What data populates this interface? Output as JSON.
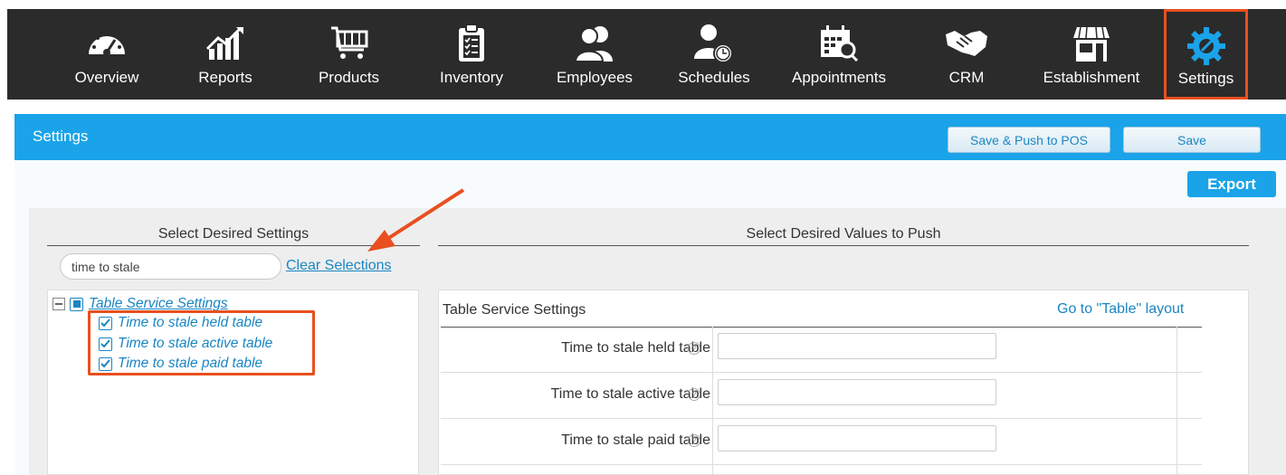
{
  "nav": {
    "items": [
      {
        "label": "Overview",
        "icon": "speedometer-icon"
      },
      {
        "label": "Reports",
        "icon": "chart-icon"
      },
      {
        "label": "Products",
        "icon": "cart-icon"
      },
      {
        "label": "Inventory",
        "icon": "clipboard-icon"
      },
      {
        "label": "Employees",
        "icon": "people-icon"
      },
      {
        "label": "Schedules",
        "icon": "person-clock-icon"
      },
      {
        "label": "Appointments",
        "icon": "calendar-search-icon"
      },
      {
        "label": "CRM",
        "icon": "handshake-icon"
      },
      {
        "label": "Establishment",
        "icon": "storefront-icon"
      },
      {
        "label": "Settings",
        "icon": "gear-wrench-icon"
      }
    ],
    "active": "Settings"
  },
  "header": {
    "title": "Settings",
    "save_push_label": "Save & Push to POS",
    "save_label": "Save"
  },
  "export_label": "Export",
  "left": {
    "heading": "Select Desired Settings",
    "search_value": "time to stale",
    "clear_label": "Clear Selections",
    "tree": {
      "group_label": "Table Service Settings",
      "items": [
        {
          "label": "Time to stale held table",
          "checked": true
        },
        {
          "label": "Time to stale active table",
          "checked": true
        },
        {
          "label": "Time to stale paid table",
          "checked": true
        }
      ]
    }
  },
  "right": {
    "heading": "Select Desired Values to Push",
    "section_title": "Table Service Settings",
    "layout_link": "Go to \"Table\" layout",
    "fields": [
      {
        "label": "Time to stale held table",
        "value": ""
      },
      {
        "label": "Time to stale active table",
        "value": ""
      },
      {
        "label": "Time to stale paid table",
        "value": ""
      }
    ],
    "help_glyph": "?"
  },
  "colors": {
    "nav_bg": "#2b2b2b",
    "accent_blue": "#1aa3e8",
    "link_blue": "#1a86c3",
    "highlight_orange": "#e8501f"
  }
}
